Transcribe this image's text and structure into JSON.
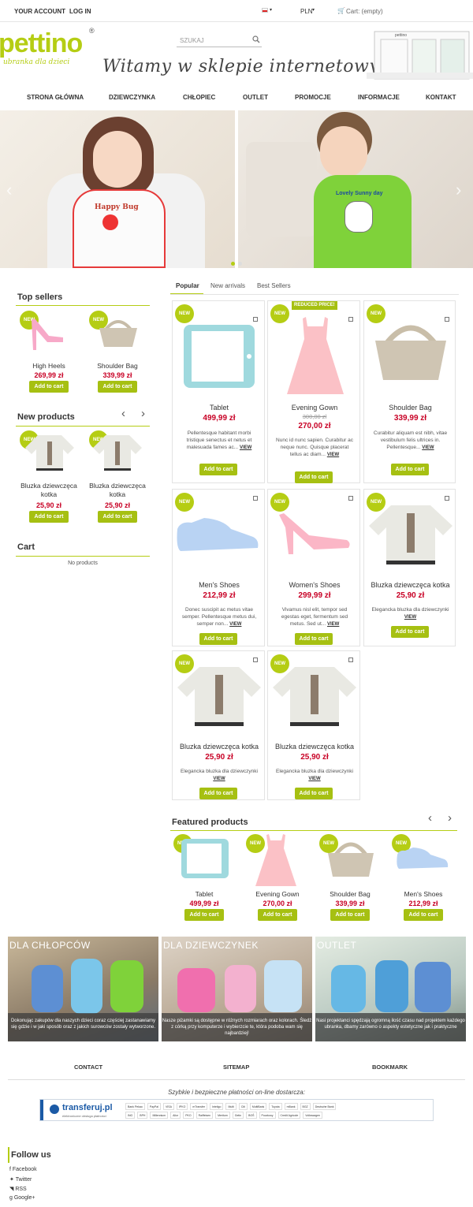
{
  "topbar": {
    "account": "YOUR ACCOUNT",
    "login": "LOG IN",
    "currency": "PLN",
    "cart": "Cart: (empty)"
  },
  "header": {
    "logo": "pettino",
    "tagline": "ubranka dla dzieci",
    "search_placeholder": "SZUKAJ",
    "welcome": "Witamy w sklepie internetowym",
    "shop_sign": "pettino"
  },
  "nav": [
    "STRONA GŁÓWNA",
    "DZIEWCZYNKA",
    "CHŁOPIEC",
    "OUTLET",
    "PROMOCJE",
    "INFORMACJE",
    "KONTAKT"
  ],
  "slider": {
    "shirt_text_left": "Happy Bug",
    "shirt_text_right": "Lovely Sunny day"
  },
  "common": {
    "add_to_cart": "Add to cart",
    "new": "NEW",
    "view": "VIEW",
    "reduced": "REDUCED PRICE!"
  },
  "top_sellers": {
    "title": "Top sellers",
    "items": [
      {
        "name": "High Heels",
        "price": "269,99 zł"
      },
      {
        "name": "Shoulder Bag",
        "price": "339,99 zł"
      }
    ]
  },
  "new_products": {
    "title": "New products",
    "items": [
      {
        "name": "Bluzka dziewczęca kotka",
        "price": "25,90 zł"
      },
      {
        "name": "Bluzka dziewczęca kotka",
        "price": "25,90 zł"
      }
    ]
  },
  "cart_block": {
    "title": "Cart",
    "empty": "No products"
  },
  "tabs": [
    "Popular",
    "New arrivals",
    "Best Sellers"
  ],
  "products": [
    {
      "name": "Tablet",
      "price": "499,99 zł",
      "old": "",
      "desc": "Pellentesque habitant morbi tristique senectus et netus et malesuada fames ac..."
    },
    {
      "name": "Evening Gown",
      "price": "270,00 zł",
      "old": "300,00 zł",
      "desc": "Nunc id nunc sapien. Curabitur ac neque nunc. Quisque placerat tellus ac diam..."
    },
    {
      "name": "Shoulder Bag",
      "price": "339,99 zł",
      "old": "",
      "desc": "Curabitur aliquam est nibh, vitae vestibulum felis ultrices in. Pellentesque..."
    },
    {
      "name": "Men's Shoes",
      "price": "212,99 zł",
      "old": "",
      "desc": "Donec suscipit ac metus vitae semper. Pellentesque metus dui, semper non..."
    },
    {
      "name": "Women's Shoes",
      "price": "299,99 zł",
      "old": "",
      "desc": "Vivamus nisl elit, tempor sed egestas eget, fermentum sed metus. Sed ut..."
    },
    {
      "name": "Bluzka dziewczęca kotka",
      "price": "25,90 zł",
      "old": "",
      "desc": "Elegancka bluzka dla dziewczynki"
    },
    {
      "name": "Bluzka dziewczęca kotka",
      "price": "25,90 zł",
      "old": "",
      "desc": "Elegancka bluzka dla dziewczynki"
    },
    {
      "name": "Bluzka dziewczęca kotka",
      "price": "25,90 zł",
      "old": "",
      "desc": "Elegancka bluzka dla dziewczynki"
    }
  ],
  "featured": {
    "title": "Featured products",
    "items": [
      {
        "name": "Tablet",
        "price": "499,99 zł"
      },
      {
        "name": "Evening Gown",
        "price": "270,00 zł"
      },
      {
        "name": "Shoulder Bag",
        "price": "339,99 zł"
      },
      {
        "name": "Men's Shoes",
        "price": "212,99 zł"
      }
    ]
  },
  "banners": [
    {
      "title": "DLA CHŁOPCÓW",
      "desc": "Dokonując zakupów dla naszych dzieci coraz częściej zastanawiamy się gdzie i w jaki sposób oraz z jakich surowców zostały wytworzone."
    },
    {
      "title": "DLA DZIEWCZYNEK",
      "desc": "Nasze piżamki są dostępne w różnych rozmiarach oraz kolorach. Śledź z córką przy komputerze i wybierzcie te, która podoba wam się najbardziej!"
    },
    {
      "title": "OUTLET",
      "desc": "Nasi projektanci spędzają ogromną ilość czasu nad projektem każdego ubranka, dbamy zarówno o aspekty estetyczne jak i praktyczne"
    }
  ],
  "footer_links": [
    "CONTACT",
    "SITEMAP",
    "BOOKMARK"
  ],
  "payment": {
    "text": "Szybkie i bezpieczne płatności on-line dostarcza:",
    "brand": "transferuj.pl",
    "brand_sub": "elektroniczne obsługa płatności",
    "banks_row1": [
      "Bank Pekao",
      "PayPal",
      "VISA",
      "IPKO",
      "mTransfer",
      "Inteligo",
      "Multi",
      "Citi",
      "MultiBank",
      "Toyota",
      "mBank",
      "BGŻ",
      "Deutsche Bank"
    ],
    "banks_row2": [
      "ING",
      "BPH",
      "Millennium",
      "Alior",
      "PKO",
      "Raiffeisen",
      "Meritum",
      "Getin",
      "BOŚ",
      "Pocztowy",
      "Credit Agricole",
      "Volkswagen"
    ]
  },
  "follow": {
    "title": "Follow us",
    "items": [
      "Facebook",
      "Twitter",
      "RSS",
      "Google+"
    ]
  },
  "colors": {
    "accent": "#b5cd14",
    "price": "#c80025",
    "button": "#a6c012"
  }
}
